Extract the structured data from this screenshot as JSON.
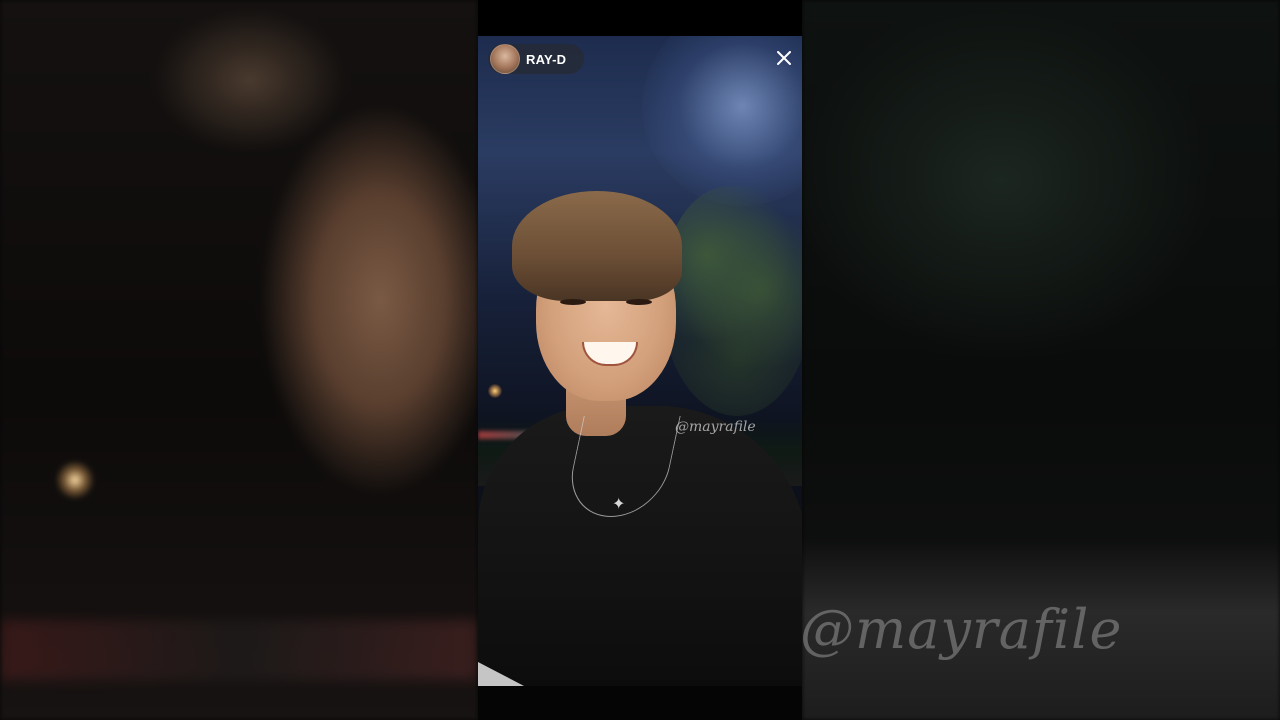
{
  "story": {
    "username": "RAY-D",
    "watermark": "@mayrafile",
    "close_icon": "close-icon",
    "avatar_icon": "avatar"
  },
  "background": {
    "watermark": "@mayrafile"
  },
  "colors": {
    "overlay_text": "#ffffff",
    "watermark": "#c8c8c8",
    "frame_background": "#000000"
  }
}
